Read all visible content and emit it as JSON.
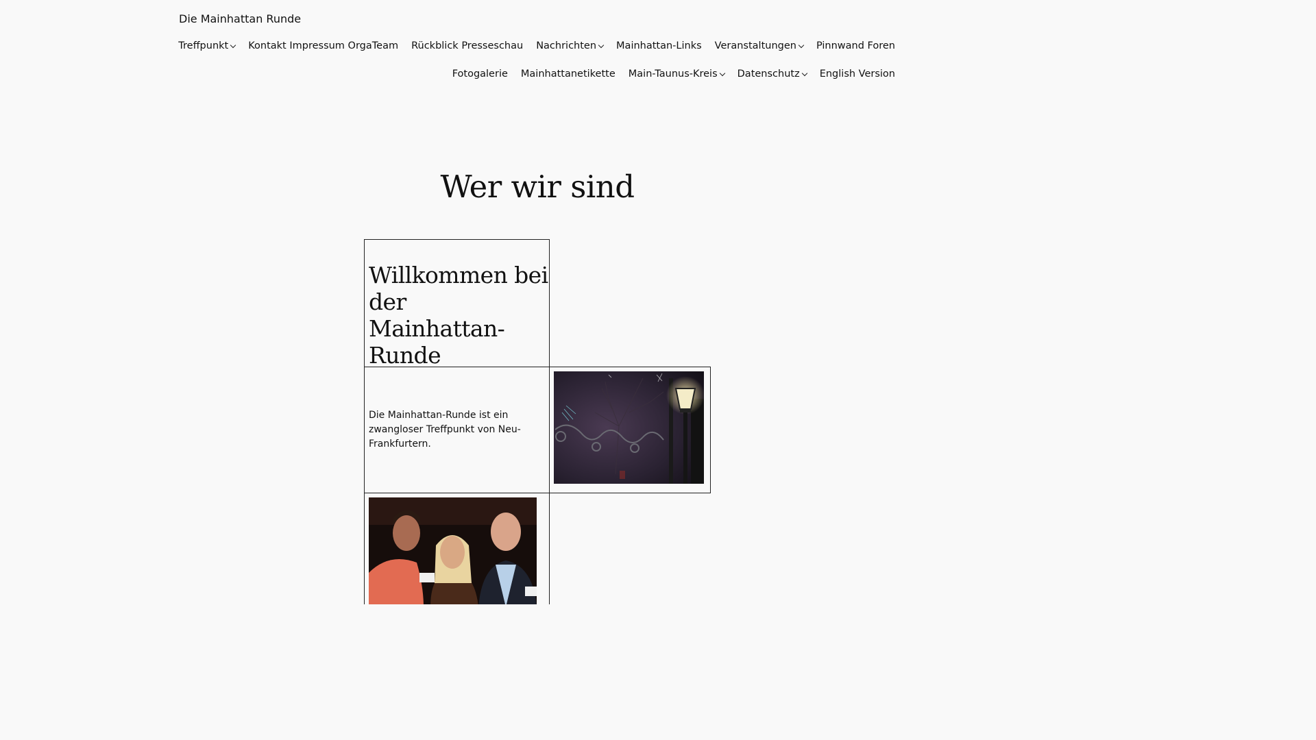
{
  "site": {
    "title": "Die Mainhattan Runde"
  },
  "nav": {
    "row1": [
      {
        "label": "Treffpunkt",
        "has_submenu": true
      },
      {
        "label": "Kontakt Impressum OrgaTeam",
        "has_submenu": false
      },
      {
        "label": "Rückblick Presseschau",
        "has_submenu": false
      },
      {
        "label": "Nachrichten",
        "has_submenu": true
      },
      {
        "label": "Mainhattan-Links",
        "has_submenu": false
      },
      {
        "label": "Veranstaltungen",
        "has_submenu": true
      },
      {
        "label": "Pinnwand Foren",
        "has_submenu": false
      }
    ],
    "row2": [
      {
        "label": "Fotogalerie",
        "has_submenu": false
      },
      {
        "label": "Mainhattanetikette",
        "has_submenu": false
      },
      {
        "label": "Main-Taunus-Kreis",
        "has_submenu": true
      },
      {
        "label": "Datenschutz",
        "has_submenu": true
      },
      {
        "label": "English Version",
        "has_submenu": false
      }
    ]
  },
  "main": {
    "heading": "Wer wir sind",
    "welcome_heading": "Willkommen bei der Mainhattan-Runde",
    "intro_text": "Die Mainhattan-Runde ist ein zwangloser Treffpunkt von Neu-Frankfurtern."
  },
  "colors": {
    "background": "#f9f9f9",
    "text": "#111111",
    "border": "#222222"
  },
  "icons": {
    "submenu_indicator": "chevron-down-icon"
  }
}
